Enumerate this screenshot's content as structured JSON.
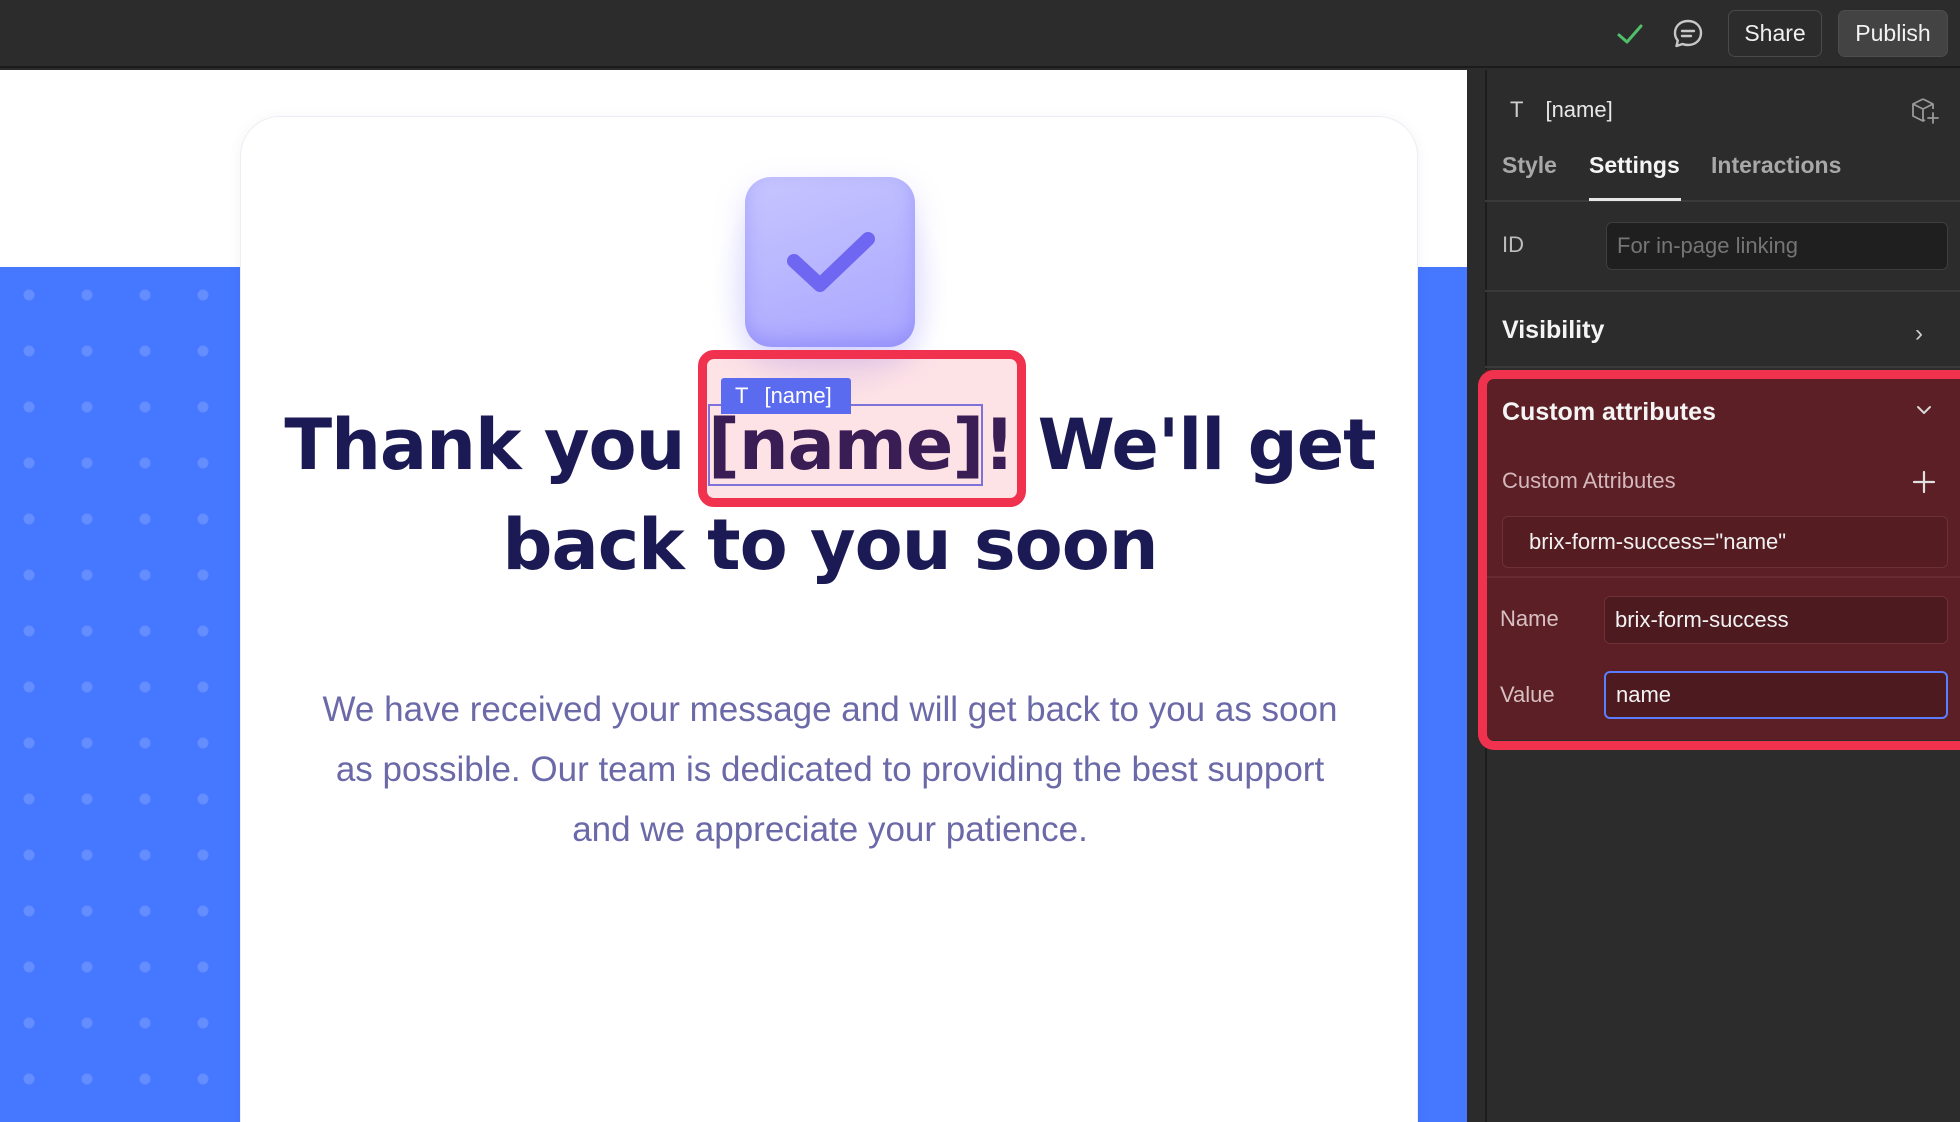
{
  "topbar": {
    "share_label": "Share",
    "publish_label": "Publish",
    "status_icon": "check-icon",
    "comment_icon": "comment-icon",
    "status_color": "#4caf50"
  },
  "canvas": {
    "heading_before": "Thank you ",
    "heading_name": "[name]",
    "heading_after": "! We'll get back to you soon",
    "body": "We have received your message and will get back to you as soon as possible. Our team is dedicated to providing the best support and we appreciate your patience.",
    "selection_label": "[name]",
    "selection_type_icon": "T",
    "accent_color": "#4677ff",
    "heading_color": "#1c1a55"
  },
  "panel": {
    "element_type_icon": "T",
    "element_name": "[name]",
    "tabs": [
      {
        "label": "Style",
        "active": false
      },
      {
        "label": "Settings",
        "active": true
      },
      {
        "label": "Interactions",
        "active": false
      }
    ],
    "id_label": "ID",
    "id_placeholder": "For in-page linking",
    "visibility_title": "Visibility",
    "custom_attributes_title": "Custom attributes",
    "custom_attributes_subtitle": "Custom Attributes",
    "attribute_row": "brix-form-success=\"name\"",
    "name_label": "Name",
    "name_value": "brix-form-success",
    "value_label": "Value",
    "value_value": "name",
    "highlight_color": "#f0324f"
  }
}
